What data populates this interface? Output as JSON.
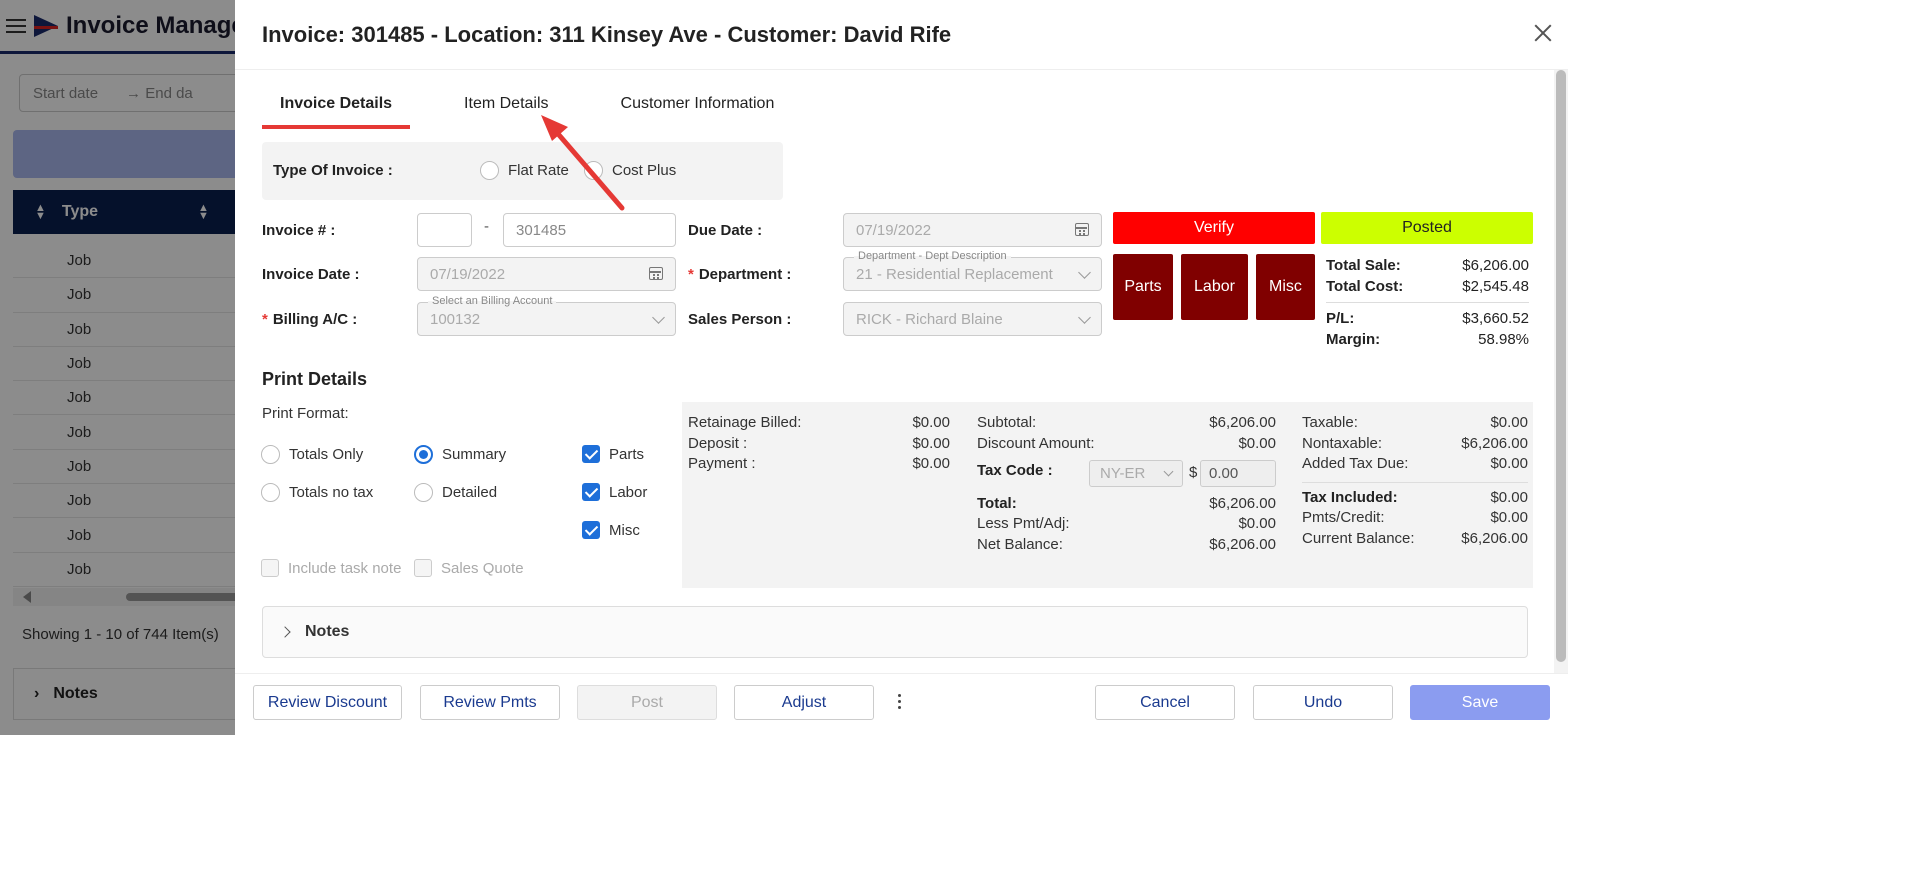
{
  "background": {
    "app_title": "Invoice Manage",
    "start_date_placeholder": "Start date",
    "end_date_placeholder": "End da",
    "table_header_type": "Type",
    "rows": [
      "Job",
      "Job",
      "Job",
      "Job",
      "Job",
      "Job",
      "Job",
      "Job",
      "Job",
      "Job"
    ],
    "showing_text": "Showing 1 - 10 of 744 Item(s)",
    "notes_label": "Notes"
  },
  "modal": {
    "title": "Invoice: 301485 - Location: 311 Kinsey Ave - Customer: David Rife",
    "tabs": [
      "Invoice Details",
      "Item Details",
      "Customer Information"
    ],
    "type_of_invoice_label": "Type Of Invoice :",
    "type_options": [
      "Flat Rate",
      "Cost Plus"
    ],
    "invoice_no_label": "Invoice # :",
    "invoice_no_prefix": "",
    "invoice_no_dash": "-",
    "invoice_no_value": "301485",
    "invoice_date_label": "Invoice Date :",
    "invoice_date_value": "07/19/2022",
    "billing_label": "Billing A/C :",
    "billing_float": "Select an Billing Account",
    "billing_value": "100132",
    "due_date_label": "Due Date :",
    "due_date_value": "07/19/2022",
    "department_label": "Department :",
    "department_float": "Department - Dept Description",
    "department_value": "21 - Residential Replacement",
    "sales_person_label": "Sales Person :",
    "sales_person_value": "RICK - Richard Blaine",
    "verify_label": "Verify",
    "posted_label": "Posted",
    "parts_label": "Parts",
    "labor_label": "Labor",
    "misc_label": "Misc",
    "totals": {
      "total_sale_label": "Total Sale:",
      "total_sale": "$6,206.00",
      "total_cost_label": "Total Cost:",
      "total_cost": "$2,545.48",
      "pl_label": "P/L:",
      "pl": "$3,660.52",
      "margin_label": "Margin:",
      "margin": "58.98%"
    },
    "print_details_title": "Print Details",
    "print_format_label": "Print Format:",
    "print_options": {
      "totals_only": "Totals Only",
      "summary": "Summary",
      "totals_no_tax": "Totals no tax",
      "detailed": "Detailed",
      "parts": "Parts",
      "labor": "Labor",
      "misc": "Misc",
      "include_task_note": "Include task note",
      "sales_quote": "Sales Quote"
    },
    "summary": {
      "retainage_label": "Retainage Billed:",
      "retainage": "$0.00",
      "deposit_label": "Deposit :",
      "deposit": "$0.00",
      "payment_label": "Payment :",
      "payment": "$0.00",
      "subtotal_label": "Subtotal:",
      "subtotal": "$6,206.00",
      "discount_label": "Discount Amount:",
      "discount": "$0.00",
      "tax_code_label": "Tax Code :",
      "tax_code": "NY-ER",
      "tax_dollar": "$",
      "tax_amount": "0.00",
      "total_label": "Total:",
      "total": "$6,206.00",
      "less_pmt_label": "Less Pmt/Adj:",
      "less_pmt": "$0.00",
      "net_balance_label": "Net Balance:",
      "net_balance": "$6,206.00",
      "taxable_label": "Taxable:",
      "taxable": "$0.00",
      "nontaxable_label": "Nontaxable:",
      "nontaxable": "$6,206.00",
      "added_tax_label": "Added Tax Due:",
      "added_tax": "$0.00",
      "tax_included_label": "Tax Included:",
      "tax_included": "$0.00",
      "pmts_credit_label": "Pmts/Credit:",
      "pmts_credit": "$0.00",
      "current_balance_label": "Current Balance:",
      "current_balance": "$6,206.00"
    },
    "notes_label": "Notes",
    "footer": {
      "review_discount": "Review Discount",
      "review_pmts": "Review Pmts",
      "post": "Post",
      "adjust": "Adjust",
      "cancel": "Cancel",
      "undo": "Undo",
      "save": "Save"
    }
  },
  "colors": {
    "accent_blue": "#1e6fd9",
    "verify_red": "#ff0000",
    "posted_lime": "#ccff00",
    "dark_red": "#800000",
    "tab_underline": "#e53935",
    "annotation_arrow": "#e53935"
  }
}
